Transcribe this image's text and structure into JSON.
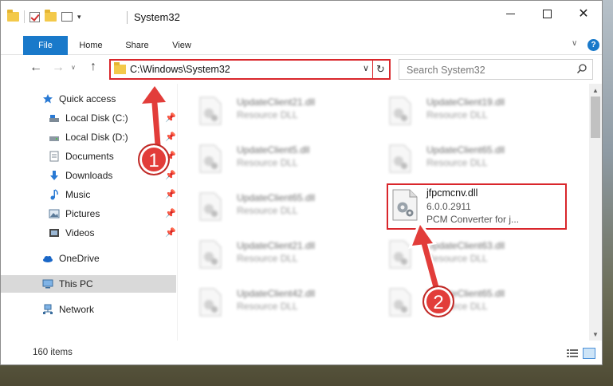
{
  "window": {
    "title": "System32"
  },
  "ribbon": {
    "tabs": [
      "File",
      "Home",
      "Share",
      "View"
    ]
  },
  "address": {
    "path": "C:\\Windows\\System32"
  },
  "search": {
    "placeholder": "Search System32"
  },
  "sidebar": {
    "items": [
      {
        "label": "Quick access",
        "icon": "star-icon"
      },
      {
        "label": "Local Disk (C:)",
        "icon": "drive-icon",
        "pinned": true
      },
      {
        "label": "Local Disk (D:)",
        "icon": "drive-icon",
        "pinned": true
      },
      {
        "label": "Documents",
        "icon": "document-icon",
        "pinned": true
      },
      {
        "label": "Downloads",
        "icon": "download-icon",
        "pinned": true
      },
      {
        "label": "Music",
        "icon": "music-icon",
        "pinned": true
      },
      {
        "label": "Pictures",
        "icon": "picture-icon",
        "pinned": true
      },
      {
        "label": "Videos",
        "icon": "video-icon",
        "pinned": true
      },
      {
        "label": "OneDrive",
        "icon": "cloud-icon"
      },
      {
        "label": "This PC",
        "icon": "computer-icon",
        "selected": true
      },
      {
        "label": "Network",
        "icon": "network-icon"
      }
    ]
  },
  "files": [
    {
      "name": "UpdateClient21.dll",
      "desc": "Resource DLL"
    },
    {
      "name": "UpdateClient19.dll",
      "desc": "Resource DLL"
    },
    {
      "name": "UpdateClient5.dll",
      "desc": "Resource DLL"
    },
    {
      "name": "UpdateClient65.dll",
      "desc": "Resource DLL"
    },
    {
      "name": "UpdateClient65.dll",
      "desc": "Resource DLL"
    },
    {
      "name": "UpdateClient21.dll",
      "desc": "Resource DLL"
    },
    {
      "name": "UpdateClient63.dll",
      "desc": "Resource DLL"
    },
    {
      "name": "UpdateClient42.dll",
      "desc": "Resource DLL"
    },
    {
      "name": "UpdateClient65.dll",
      "desc": "Resource DLL"
    }
  ],
  "highlighted_file": {
    "name": "jfpcmcnv.dll",
    "version": "6.0.0.2911",
    "desc": "PCM Converter for j..."
  },
  "status": {
    "item_count": "160 items"
  },
  "annotations": {
    "step1": "1",
    "step2": "2"
  },
  "colors": {
    "accent": "#1979ca",
    "highlight": "#d9262b",
    "selected": "#d9d9d9"
  }
}
